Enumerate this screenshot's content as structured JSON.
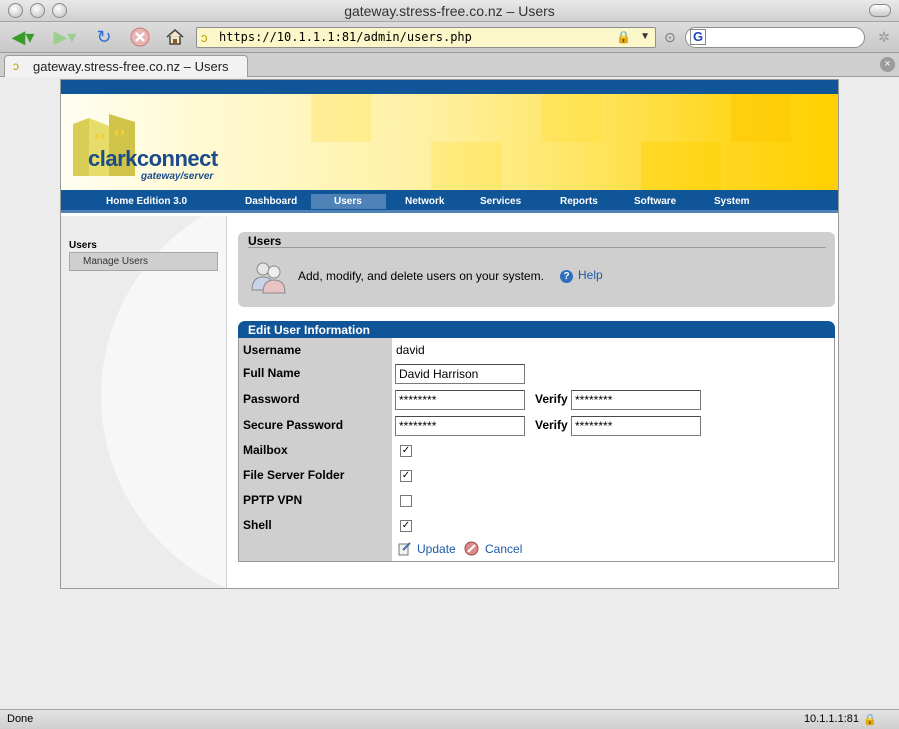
{
  "window": {
    "title": "gateway.stress-free.co.nz – Users"
  },
  "toolbar": {
    "url": "https://10.1.1.1:81/admin/users.php",
    "search_placeholder": ""
  },
  "tab": {
    "label": "gateway.stress-free.co.nz – Users"
  },
  "brand": {
    "name": "clarkconnect",
    "tagline": "gateway/server"
  },
  "nav": {
    "edition": "Home Edition 3.0",
    "items": [
      "Dashboard",
      "Users",
      "Network",
      "Services",
      "Reports",
      "Software",
      "System"
    ],
    "active": "Users"
  },
  "sidebar": {
    "title": "Users",
    "items": [
      "Manage Users"
    ]
  },
  "users_panel": {
    "title": "Users",
    "description": "Add, modify, and delete users on your system.",
    "help": "Help"
  },
  "form": {
    "title": "Edit User Information",
    "username_label": "Username",
    "username_value": "david",
    "fullname_label": "Full Name",
    "fullname_value": "David Harrison",
    "password_label": "Password",
    "password_value": "********",
    "password_verify_label": "Verify",
    "password_verify_value": "********",
    "secure_label": "Secure Password",
    "secure_value": "********",
    "secure_verify_label": "Verify",
    "secure_verify_value": "********",
    "mailbox_label": "Mailbox",
    "mailbox_checked": true,
    "fileserver_label": "File Server Folder",
    "fileserver_checked": true,
    "pptp_label": "PPTP VPN",
    "pptp_checked": false,
    "shell_label": "Shell",
    "shell_checked": true,
    "update": "Update",
    "cancel": "Cancel"
  },
  "status": {
    "left": "Done",
    "right": "10.1.1.1:81"
  },
  "colors": {
    "navy": "#0f5598",
    "accent": "#ffd71f",
    "panel_gray": "#cfcfcf",
    "link": "#1d5aa6"
  }
}
